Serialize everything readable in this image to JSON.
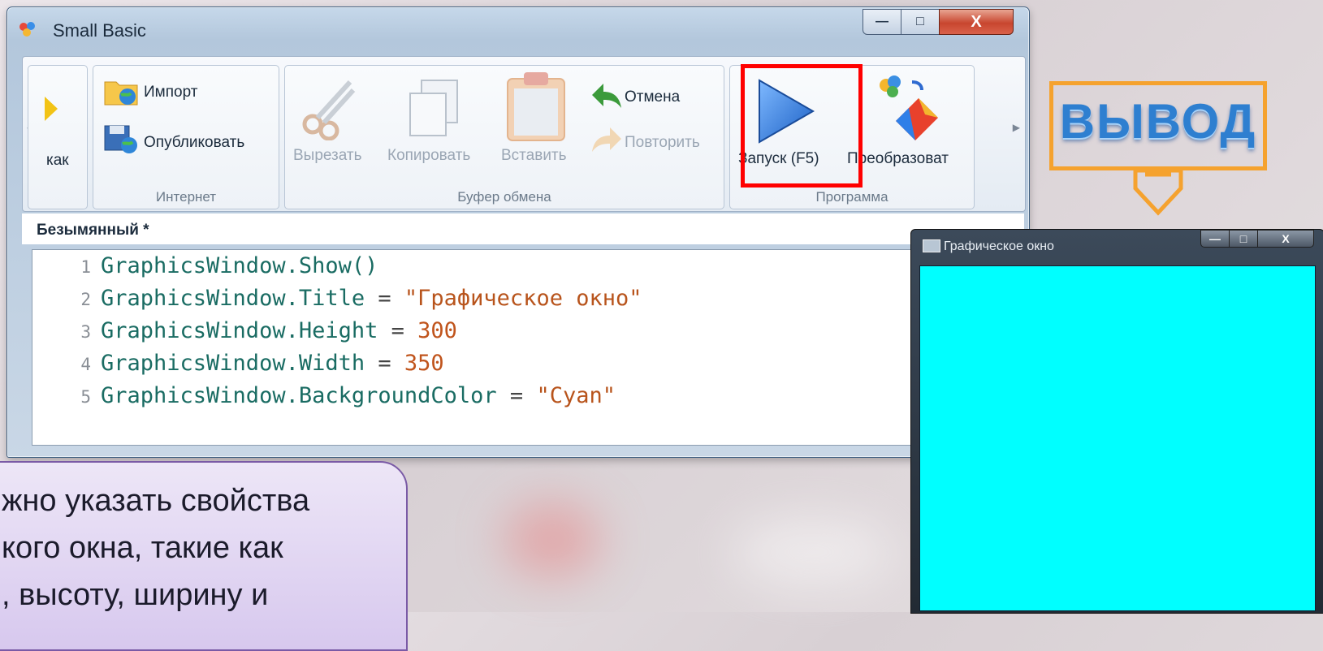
{
  "window": {
    "title": "Small Basic",
    "icon": "small-basic-icon",
    "controls": {
      "minimize": "—",
      "maximize": "□",
      "close": "X"
    }
  },
  "ribbon": {
    "partial_label": "как",
    "groups": [
      {
        "name": "Интернет",
        "items": [
          "Импорт",
          "Опубликовать"
        ]
      },
      {
        "name": "Буфер обмена",
        "items": [
          "Вырезать",
          "Копировать",
          "Вставить",
          "Отмена",
          "Повторить"
        ]
      },
      {
        "name": "Программа",
        "items": [
          "Запуск (F5)",
          "Преобразовать"
        ]
      }
    ],
    "internet_label": "Интернет",
    "clipboard_label": "Буфер обмена",
    "program_label": "Программа",
    "import": "Импорт",
    "publish": "Опубликовать",
    "cut": "Вырезать",
    "copy": "Копировать",
    "paste": "Вставить",
    "undo": "Отмена",
    "redo": "Повторить",
    "run": "Запуск (F5)",
    "convert": "Преобразоват"
  },
  "document": {
    "tab_title": "Безымянный *"
  },
  "code": {
    "lines": [
      {
        "n": "1",
        "id": "GraphicsWindow.Show()",
        "op": "",
        "val": ""
      },
      {
        "n": "2",
        "id": "GraphicsWindow.Title",
        "op": " = ",
        "val": "\"Графическое окно\""
      },
      {
        "n": "3",
        "id": "GraphicsWindow.Height",
        "op": " = ",
        "val": "300"
      },
      {
        "n": "4",
        "id": "GraphicsWindow.Width",
        "op": " = ",
        "val": "350"
      },
      {
        "n": "5",
        "id": "GraphicsWindow.BackgroundColor",
        "op": " = ",
        "val": "\"Cyan\""
      }
    ]
  },
  "callout": {
    "text": "ВЫВОД"
  },
  "graphics_window": {
    "title": "Графическое окно",
    "background": "#00FFFF"
  },
  "note": {
    "lines": [
      "жно указать свойства",
      "кого окна, такие как",
      ", высоту, ширину и"
    ]
  },
  "colors": {
    "run_highlight": "#FF0000",
    "callout_border": "#F5A22E",
    "note_border": "#7A5AA6"
  }
}
